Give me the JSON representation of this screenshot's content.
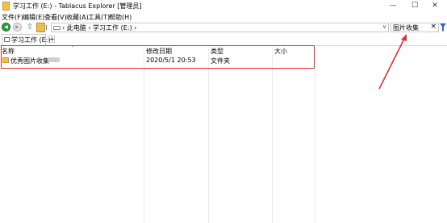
{
  "window": {
    "title": "学习工作 (E:) - Tablacus Explorer [管理员]",
    "minimize_glyph": "—",
    "maximize_glyph": "☐",
    "close_glyph": "✕"
  },
  "menu": {
    "items": [
      "文件(F)",
      "编辑(E)",
      "查看(V)",
      "收藏(A)",
      "工具(T)",
      "帮助(H)"
    ]
  },
  "toolbar": {
    "back_glyph": "◀",
    "forward_glyph": "▶",
    "up_glyph": "⇧",
    "address": {
      "crumbs": [
        "此电脑",
        "学习工作 (E:)"
      ],
      "separator": "›",
      "dropdown_glyph": "∨"
    },
    "search": {
      "value": "图片收集",
      "clear_glyph": "×",
      "filter_icon": "filter-icon",
      "filter_color": "#2f6ad6"
    }
  },
  "tabs": {
    "items": [
      {
        "label": "学习工作 (E:)"
      }
    ],
    "add_glyph": "+"
  },
  "file_list": {
    "columns": {
      "name": "名称",
      "modified": "修改日期",
      "type": "类型",
      "size": "大小"
    },
    "rows": [
      {
        "name": "优秀图片收集",
        "modified": "2020/5/1 20:53",
        "type": "文件夹",
        "size": ""
      }
    ]
  },
  "annotation": {
    "color": "#e03131"
  }
}
